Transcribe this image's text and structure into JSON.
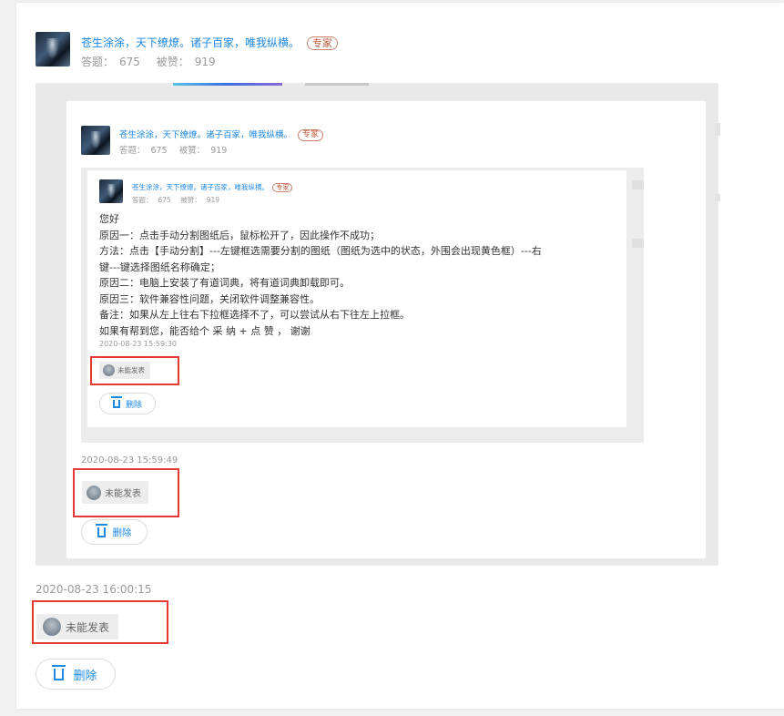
{
  "outer": {
    "user": {
      "name": "苍生涂涂，天下缭燎。诸子百家，唯我纵横。",
      "badge": "专家"
    },
    "stats": {
      "answers_label": "答题：",
      "answers": "675",
      "likes_label": "被赞：",
      "likes": "919"
    },
    "timestamp": "2020-08-23 16:00:15",
    "status": "未能发表",
    "delete_label": "删除"
  },
  "middle": {
    "user": {
      "name": "苍生涂涂，天下缭燎。诸子百家，唯我纵横。",
      "badge": "专家"
    },
    "stats": {
      "answers_label": "答题：",
      "answers": "675",
      "likes_label": "被赞：",
      "likes": "919"
    },
    "timestamp": "2020-08-23 15:59:49",
    "status": "未能发表",
    "delete_label": "删除"
  },
  "inner": {
    "user": {
      "name": "苍生涂涂，天下缭燎。诸子百家，唯我纵横。",
      "badge": "专家"
    },
    "stats": {
      "answers_label": "答题：",
      "answers": "675",
      "likes_label": "被赞：",
      "likes": "919"
    },
    "lines": [
      "您好",
      "原因一：点击手动分割图纸后，鼠标松开了，因此操作不成功；",
      "方法：点击【手动分割】---左键框选需要分割的图纸（图纸为选中的状态，外围会出现黄色框）---右",
      "键---键选择图纸名称确定；",
      "原因二：电脑上安装了有道词典，将有道词典卸载即可。",
      "原因三：软件兼容性问题，关闭软件调整兼容性。",
      "备注：如果从左上往右下拉框选择不了，可以尝试从右下往左上拉框。",
      "如果有帮到您，能否给个 采 纳 + 点 赞 ， 谢谢"
    ],
    "timestamp": "2020-08-23 15:59:30",
    "status": "未能发表",
    "delete_label": "删除"
  }
}
